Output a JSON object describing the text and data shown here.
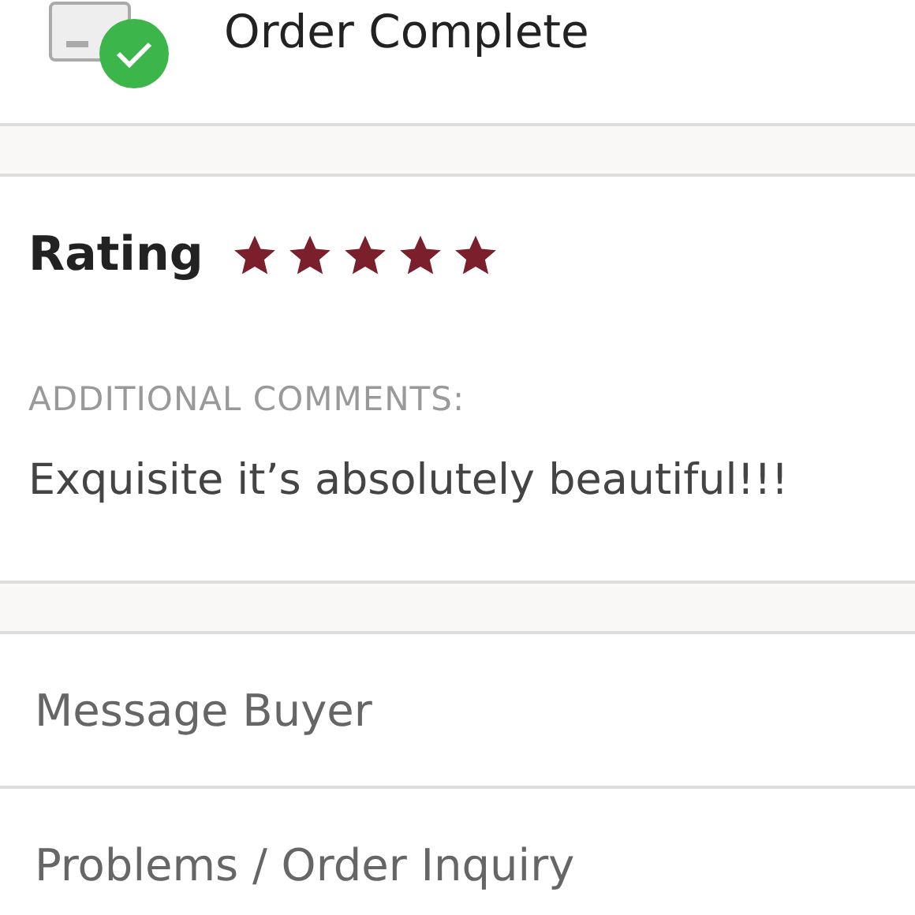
{
  "order_status": {
    "title": "Order Complete",
    "completed": true
  },
  "rating": {
    "label": "Rating",
    "stars": 5
  },
  "comments": {
    "heading": "ADDITIONAL COMMENTS:",
    "text": "Exquisite it’s absolutely beautiful!!!"
  },
  "actions": [
    "Message Buyer",
    "Problems / Order Inquiry"
  ]
}
